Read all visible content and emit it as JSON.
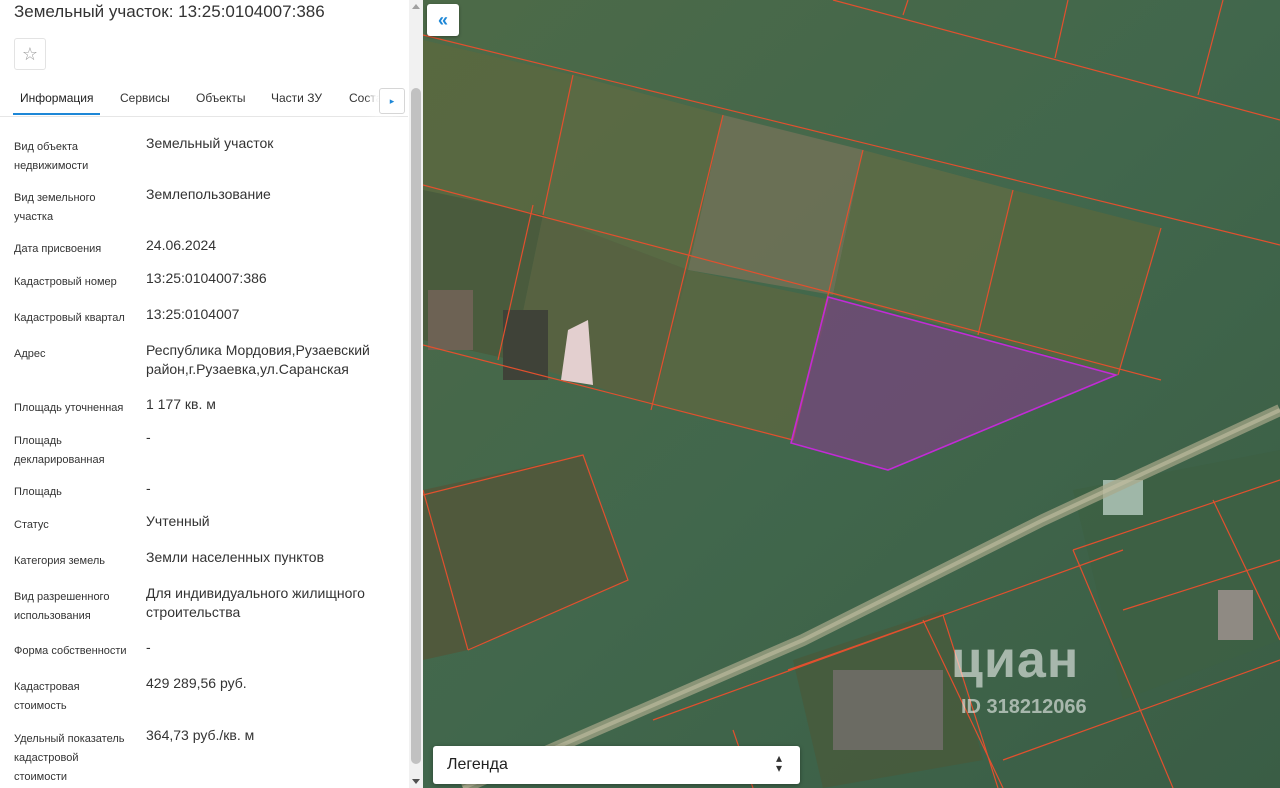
{
  "header": {
    "title": "Земельный участок: 13:25:0104007:386"
  },
  "favorite": {
    "icon": "star-outline-icon",
    "glyph": "☆"
  },
  "tabs": [
    {
      "label": "Информация",
      "active": true
    },
    {
      "label": "Сервисы",
      "active": false
    },
    {
      "label": "Объекты",
      "active": false
    },
    {
      "label": "Части ЗУ",
      "active": false
    },
    {
      "label": "Состав",
      "active": false
    }
  ],
  "tabs_next": {
    "icon": "chevron-right-icon",
    "glyph": "▸"
  },
  "details": [
    {
      "label": "Вид объекта недвижимости",
      "value": "Земельный участок"
    },
    {
      "label": "Вид земельного участка",
      "value": "Землепользование"
    },
    {
      "label": "Дата присвоения",
      "value": "24.06.2024"
    },
    {
      "label": "Кадастровый номер",
      "value": "13:25:0104007:386"
    },
    {
      "label": "Кадастровый квартал",
      "value": "13:25:0104007"
    },
    {
      "label": "Адрес",
      "value": "Республика Мордовия,Рузаевский район,г.Рузаевка,ул.Саранская"
    },
    {
      "label": "Площадь уточненная",
      "value": "1 177 кв. м"
    },
    {
      "label": "Площадь декларированная",
      "value": "-"
    },
    {
      "label": "Площадь",
      "value": "-"
    },
    {
      "label": "Статус",
      "value": "Учтенный"
    },
    {
      "label": "Категория земель",
      "value": "Земли населенных пунктов"
    },
    {
      "label": "Вид разрешенного использования",
      "value": "Для индивидуального жилищного строительства"
    },
    {
      "label": "Форма собственности",
      "value": "-"
    },
    {
      "label": "Кадастровая стоимость",
      "value": "429 289,56 руб."
    },
    {
      "label": "Удельный показатель кадастровой стоимости",
      "value": "364,73 руб./кв. м"
    }
  ],
  "map": {
    "collapse_icon": "double-chevron-left-icon",
    "collapse_glyph": "«",
    "legend_label": "Легенда",
    "legend_toggle_icon": "up-down-chevron-icon",
    "legend_toggle_glyph": "⌃⌄",
    "watermark_brand": "циан",
    "watermark_id": "ID 318212066",
    "colors": {
      "parcel_border": "#e2502e",
      "selected_fill": "#8a3a8f",
      "selected_border": "#c22bd6",
      "accent": "#1d87d7"
    }
  }
}
